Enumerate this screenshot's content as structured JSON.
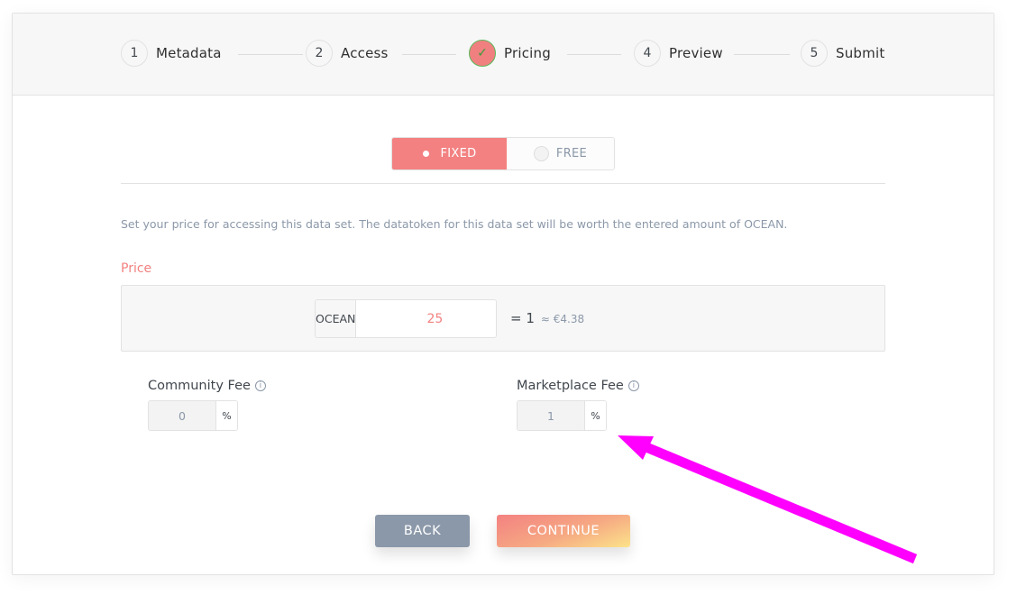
{
  "stepper": {
    "steps": [
      {
        "number": "1",
        "label": "Metadata",
        "state": "todo"
      },
      {
        "number": "2",
        "label": "Access",
        "state": "todo"
      },
      {
        "number": "✓",
        "label": "Pricing",
        "state": "current-done"
      },
      {
        "number": "4",
        "label": "Preview",
        "state": "todo"
      },
      {
        "number": "5",
        "label": "Submit",
        "state": "todo"
      }
    ]
  },
  "pricing_type": {
    "options": [
      {
        "label": "FIXED",
        "selected": true
      },
      {
        "label": "FREE",
        "selected": false
      }
    ]
  },
  "help_text": "Set your price for accessing this data set. The datatoken for this data set will be worth the entered amount of OCEAN.",
  "price": {
    "label": "Price",
    "currency": "OCEAN",
    "value": "25",
    "conversion_equals": "= 1",
    "conversion_fiat": "≈ €4.38"
  },
  "fees": {
    "community": {
      "label": "Community Fee",
      "value": "0",
      "unit": "%"
    },
    "marketplace": {
      "label": "Marketplace Fee",
      "value": "1",
      "unit": "%"
    }
  },
  "icons": {
    "info": "ⓘ",
    "check": "✓"
  },
  "buttons": {
    "back": "BACK",
    "continue": "CONTINUE"
  },
  "colors": {
    "accent": "#f38181",
    "secondary": "#8b98a9",
    "annotation_arrow": "#ff00ff"
  }
}
